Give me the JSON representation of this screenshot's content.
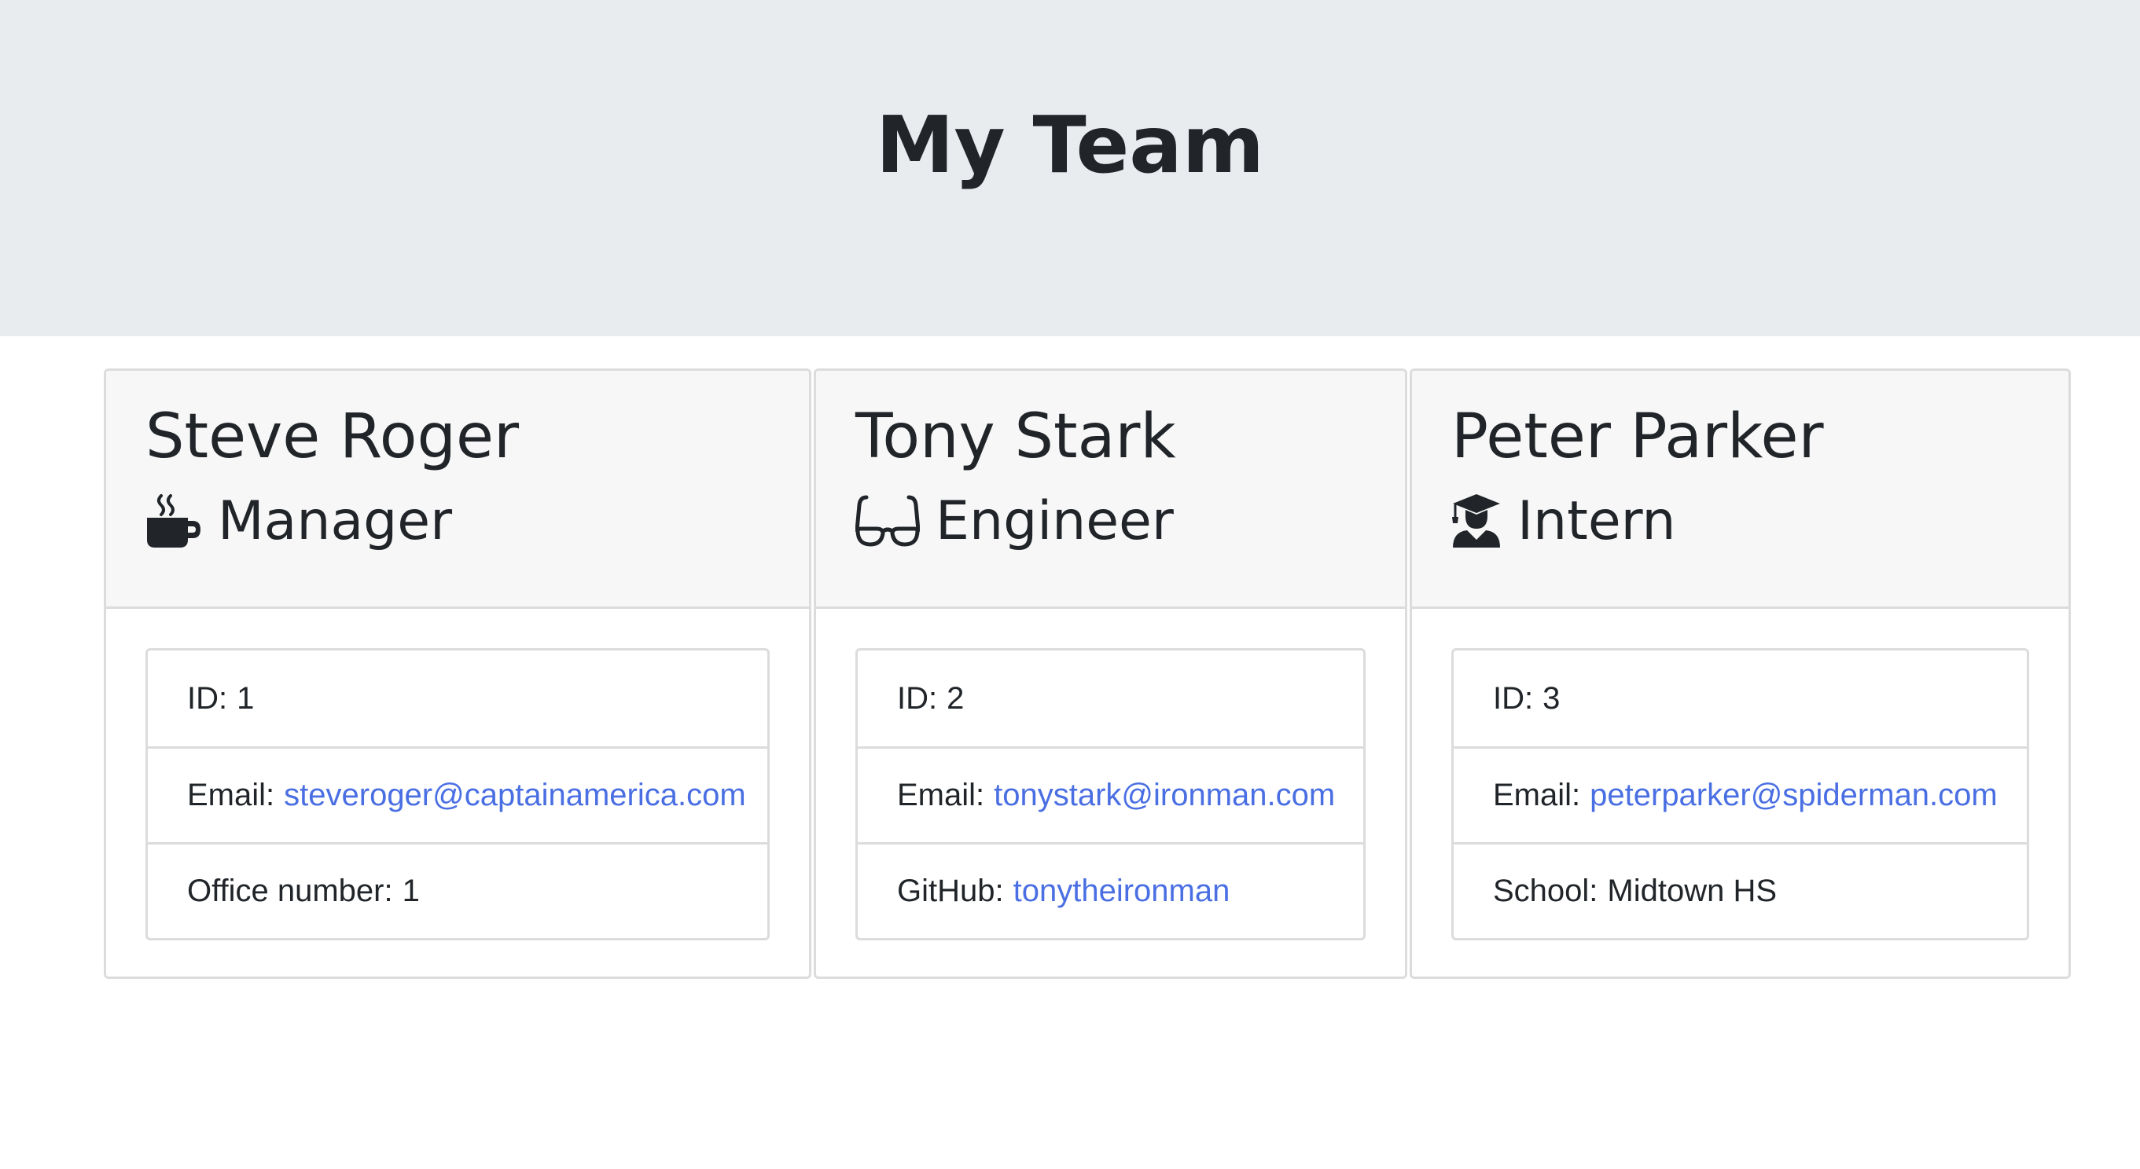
{
  "header": {
    "title": "My Team"
  },
  "employees": [
    {
      "name": "Steve Roger",
      "role": "Manager",
      "role_icon": "coffee-mug-icon",
      "id_label": "ID:",
      "id_value": "1",
      "email_label": "Email:",
      "email": "steveroger@captainamerica.com",
      "extra_label": "Office number:",
      "extra_value": "1"
    },
    {
      "name": "Tony Stark",
      "role": "Engineer",
      "role_icon": "glasses-icon",
      "id_label": "ID:",
      "id_value": "2",
      "email_label": "Email:",
      "email": "tonystark@ironman.com",
      "extra_label": "GitHub:",
      "extra_value": "tonytheironman"
    },
    {
      "name": "Peter Parker",
      "role": "Intern",
      "role_icon": "graduate-icon",
      "id_label": "ID:",
      "id_value": "3",
      "email_label": "Email:",
      "email": "peterparker@spiderman.com",
      "extra_label": "School:",
      "extra_value": "Midtown HS"
    }
  ],
  "colors": {
    "header_bg": "#e9ecef",
    "card_header_bg": "#f7f7f7",
    "text": "#212529",
    "link": "#4a6fe3",
    "border": "#dcdcdc"
  }
}
